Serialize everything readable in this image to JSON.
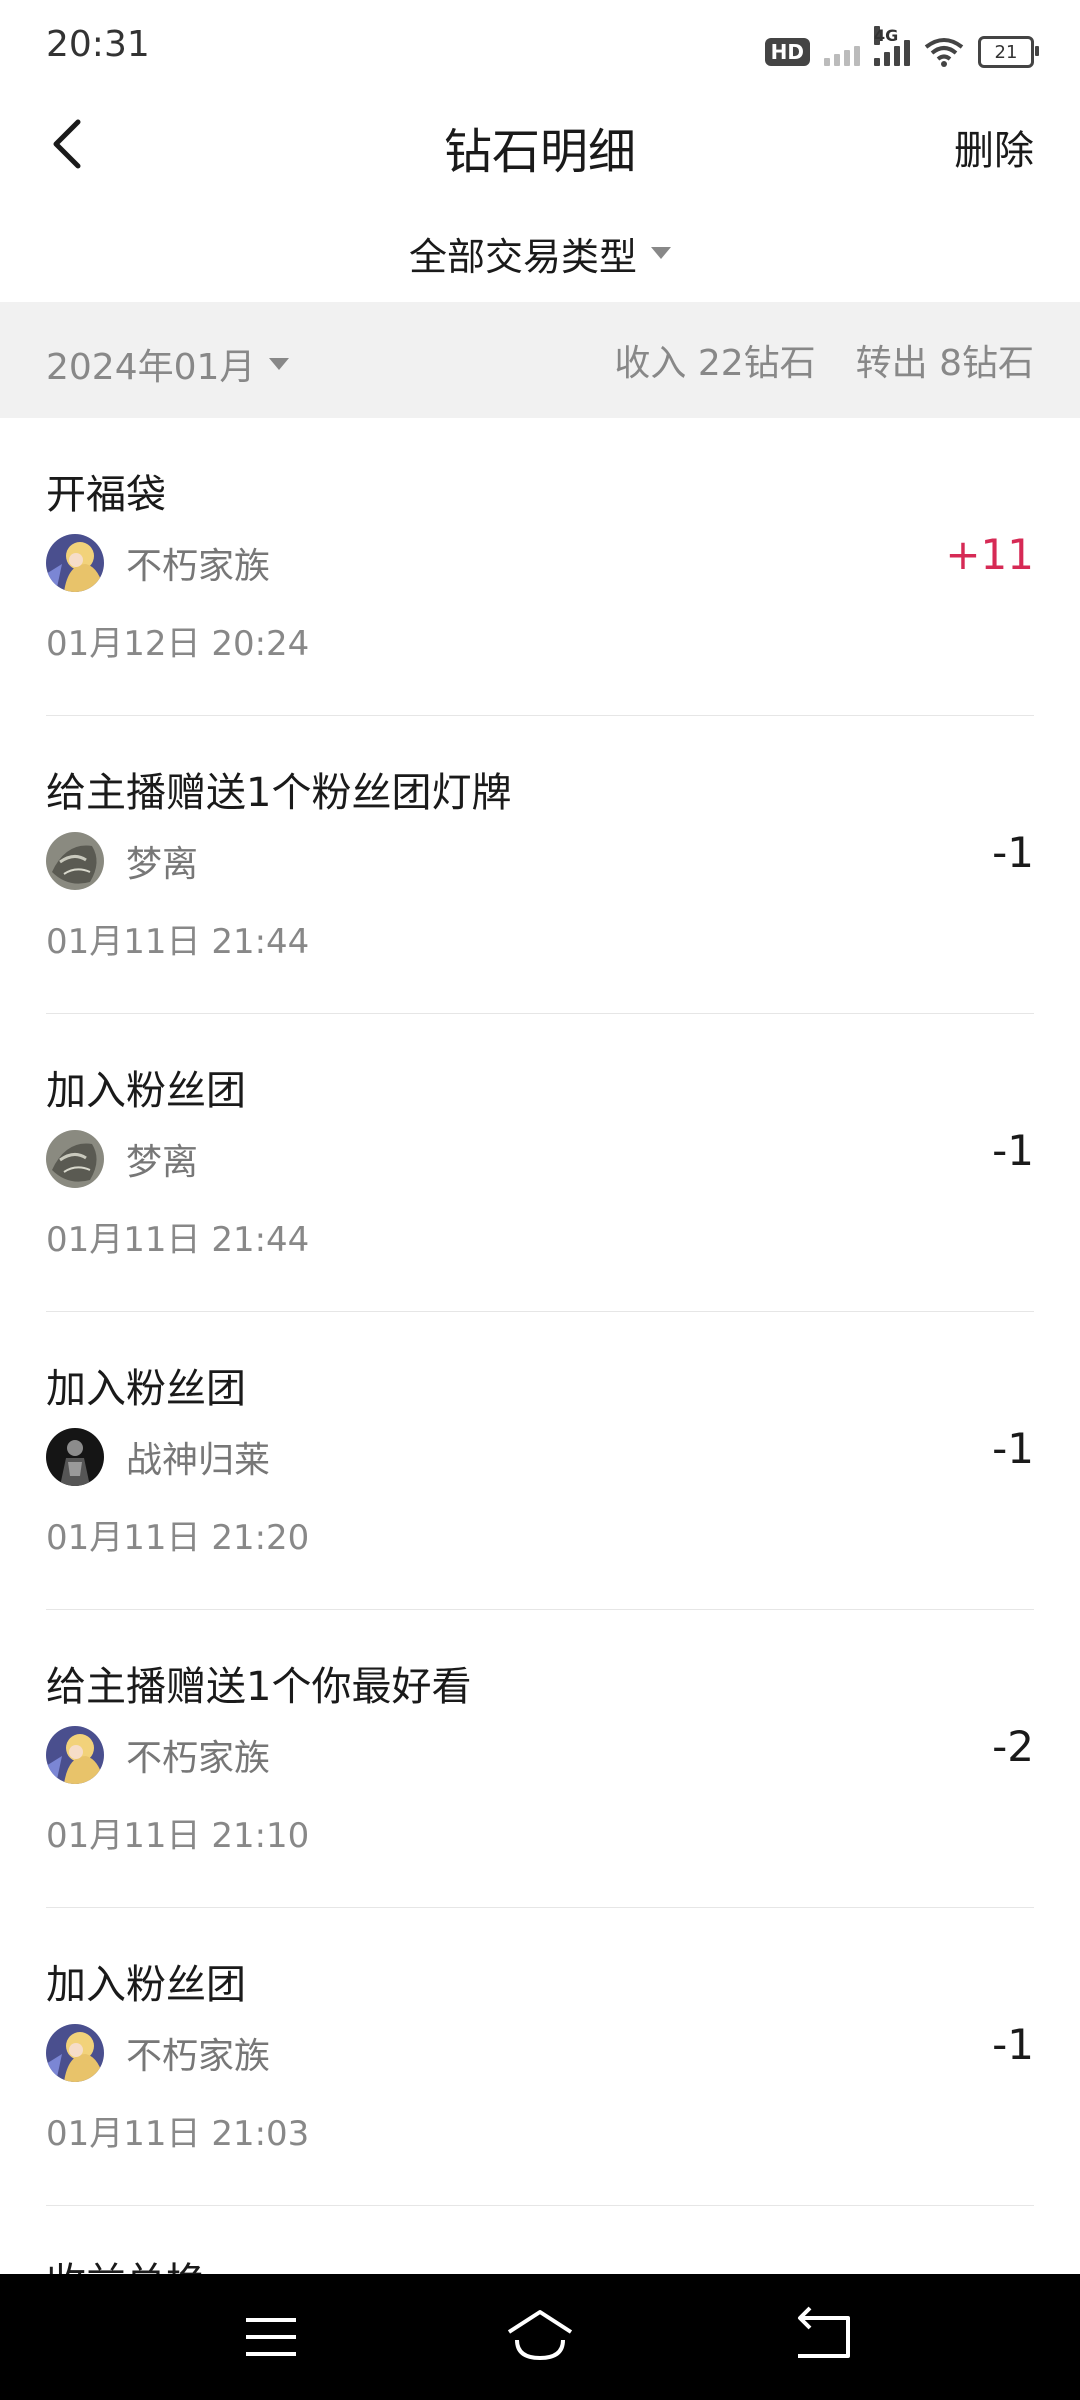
{
  "status": {
    "time": "20:31",
    "hd_label": "HD",
    "network_label": "4G",
    "battery_level": "21"
  },
  "header": {
    "title": "钻石明细",
    "action_label": "删除"
  },
  "filter": {
    "label": "全部交易类型"
  },
  "month_bar": {
    "month": "2024年01月",
    "income": "收入 22钻石",
    "outgoing": "转出 8钻石"
  },
  "transactions": [
    {
      "title": "开福袋",
      "user": "不朽家族",
      "time": "01月12日 20:24",
      "amount": "+11",
      "avatar": "anime-blonde-avatar"
    },
    {
      "title": "给主播赠送1个粉丝团灯牌",
      "user": "梦离",
      "time": "01月11日 21:44",
      "amount": "-1",
      "avatar": "grey-sketch-avatar"
    },
    {
      "title": "加入粉丝团",
      "user": "梦离",
      "time": "01月11日 21:44",
      "amount": "-1",
      "avatar": "grey-sketch-avatar"
    },
    {
      "title": "加入粉丝团",
      "user": "战神归莱",
      "time": "01月11日 21:20",
      "amount": "-1",
      "avatar": "dark-warrior-avatar"
    },
    {
      "title": "给主播赠送1个你最好看",
      "user": "不朽家族",
      "time": "01月11日 21:10",
      "amount": "-2",
      "avatar": "anime-blonde-avatar"
    },
    {
      "title": "加入粉丝团",
      "user": "不朽家族",
      "time": "01月11日 21:03",
      "amount": "-1",
      "avatar": "anime-blonde-avatar"
    }
  ],
  "partial_item_title": "收益兑换",
  "colors": {
    "positive_amount": "#d62a55",
    "month_bar_bg": "#f1f1f1",
    "nav_bar_bg": "#000000"
  },
  "icons": {
    "back": "chevron-left-icon",
    "filter_caret": "caret-down-icon",
    "nav_menu": "menu-icon",
    "nav_home": "home-icon",
    "nav_back": "back-arrow-icon"
  }
}
